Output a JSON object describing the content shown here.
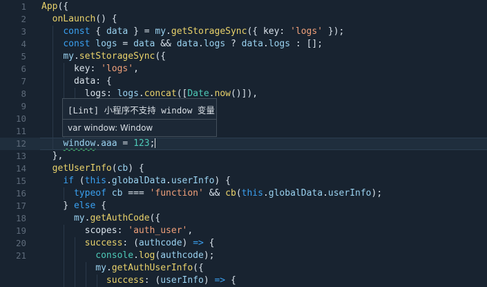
{
  "editor": {
    "lines": [
      {
        "n": "1",
        "tokens": [
          [
            "fn",
            "App"
          ],
          [
            "plain",
            "({"
          ]
        ]
      },
      {
        "n": "2",
        "tokens": [
          [
            "plain",
            "  "
          ],
          [
            "fn",
            "onLaunch"
          ],
          [
            "plain",
            "() {"
          ]
        ]
      },
      {
        "n": "3",
        "tokens": [
          [
            "plain",
            "    "
          ],
          [
            "kw",
            "const"
          ],
          [
            "plain",
            " { "
          ],
          [
            "var",
            "data"
          ],
          [
            "plain",
            " } = "
          ],
          [
            "var",
            "my"
          ],
          [
            "plain",
            "."
          ],
          [
            "fn",
            "getStorageSync"
          ],
          [
            "plain",
            "({ "
          ],
          [
            "prop",
            "key"
          ],
          [
            "plain",
            ": "
          ],
          [
            "str",
            "'logs'"
          ],
          [
            "plain",
            " });"
          ]
        ]
      },
      {
        "n": "4",
        "tokens": [
          [
            "plain",
            "    "
          ],
          [
            "kw",
            "const"
          ],
          [
            "plain",
            " "
          ],
          [
            "var",
            "logs"
          ],
          [
            "plain",
            " = "
          ],
          [
            "var",
            "data"
          ],
          [
            "plain",
            " && "
          ],
          [
            "var",
            "data"
          ],
          [
            "plain",
            "."
          ],
          [
            "var",
            "logs"
          ],
          [
            "plain",
            " ? "
          ],
          [
            "var",
            "data"
          ],
          [
            "plain",
            "."
          ],
          [
            "var",
            "logs"
          ],
          [
            "plain",
            " : [];"
          ]
        ]
      },
      {
        "n": "5",
        "tokens": [
          [
            "plain",
            "    "
          ],
          [
            "var",
            "my"
          ],
          [
            "plain",
            "."
          ],
          [
            "fn",
            "setStorageSync"
          ],
          [
            "plain",
            "({"
          ]
        ]
      },
      {
        "n": "6",
        "tokens": [
          [
            "plain",
            "      "
          ],
          [
            "prop",
            "key"
          ],
          [
            "plain",
            ": "
          ],
          [
            "str",
            "'logs'"
          ],
          [
            "plain",
            ","
          ]
        ]
      },
      {
        "n": "7",
        "tokens": [
          [
            "plain",
            "      "
          ],
          [
            "prop",
            "data"
          ],
          [
            "plain",
            ": {"
          ]
        ]
      },
      {
        "n": "8",
        "tokens": [
          [
            "plain",
            "        "
          ],
          [
            "prop",
            "logs"
          ],
          [
            "plain",
            ": "
          ],
          [
            "var",
            "logs"
          ],
          [
            "plain",
            "."
          ],
          [
            "fn",
            "concat"
          ],
          [
            "plain",
            "(["
          ],
          [
            "cls",
            "Date"
          ],
          [
            "plain",
            "."
          ],
          [
            "fn",
            "now"
          ],
          [
            "plain",
            "()]),"
          ]
        ]
      },
      {
        "n": "9",
        "tokens": []
      },
      {
        "n": "10",
        "tokens": []
      },
      {
        "n": "11",
        "tokens": []
      },
      {
        "n": "12",
        "tokens": [
          [
            "plain",
            "    "
          ],
          [
            "var squiggle",
            "window"
          ],
          [
            "plain",
            "."
          ],
          [
            "var",
            "aaa"
          ],
          [
            "plain",
            " = "
          ],
          [
            "cls",
            "123"
          ],
          [
            "plain",
            ";"
          ]
        ],
        "active": true
      },
      {
        "n": "13",
        "tokens": [
          [
            "plain",
            "  },"
          ]
        ]
      },
      {
        "n": "14",
        "tokens": [
          [
            "plain",
            "  "
          ],
          [
            "fn",
            "getUserInfo"
          ],
          [
            "plain",
            "("
          ],
          [
            "var",
            "cb"
          ],
          [
            "plain",
            ") {"
          ]
        ]
      },
      {
        "n": "15",
        "tokens": [
          [
            "plain",
            "    "
          ],
          [
            "kw",
            "if"
          ],
          [
            "plain",
            " ("
          ],
          [
            "kw",
            "this"
          ],
          [
            "plain",
            "."
          ],
          [
            "var",
            "globalData"
          ],
          [
            "plain",
            "."
          ],
          [
            "var",
            "userInfo"
          ],
          [
            "plain",
            ") {"
          ]
        ]
      },
      {
        "n": "16",
        "tokens": [
          [
            "plain",
            "      "
          ],
          [
            "kw",
            "typeof"
          ],
          [
            "plain",
            " "
          ],
          [
            "var",
            "cb"
          ],
          [
            "plain",
            " === "
          ],
          [
            "str",
            "'function'"
          ],
          [
            "plain",
            " && "
          ],
          [
            "fn",
            "cb"
          ],
          [
            "plain",
            "("
          ],
          [
            "kw",
            "this"
          ],
          [
            "plain",
            "."
          ],
          [
            "var",
            "globalData"
          ],
          [
            "plain",
            "."
          ],
          [
            "var",
            "userInfo"
          ],
          [
            "plain",
            ");"
          ]
        ]
      },
      {
        "n": "17",
        "tokens": [
          [
            "plain",
            "    } "
          ],
          [
            "kw",
            "else"
          ],
          [
            "plain",
            " {"
          ]
        ]
      },
      {
        "n": "18",
        "tokens": [
          [
            "plain",
            "      "
          ],
          [
            "var",
            "my"
          ],
          [
            "plain",
            "."
          ],
          [
            "fn",
            "getAuthCode"
          ],
          [
            "plain",
            "({"
          ]
        ]
      },
      {
        "n": "19",
        "tokens": [
          [
            "plain",
            "        "
          ],
          [
            "prop",
            "scopes"
          ],
          [
            "plain",
            ": "
          ],
          [
            "str",
            "'auth_user'"
          ],
          [
            "plain",
            ","
          ]
        ]
      },
      {
        "n": "20",
        "tokens": [
          [
            "plain",
            "        "
          ],
          [
            "fn",
            "success"
          ],
          [
            "plain",
            ": ("
          ],
          [
            "var",
            "authcode"
          ],
          [
            "plain",
            ") "
          ],
          [
            "kw",
            "=>"
          ],
          [
            "plain",
            " {"
          ]
        ]
      },
      {
        "n": "21",
        "tokens": [
          [
            "plain",
            "          "
          ],
          [
            "cls",
            "console"
          ],
          [
            "plain",
            "."
          ],
          [
            "fn",
            "log"
          ],
          [
            "plain",
            "("
          ],
          [
            "var",
            "authcode"
          ],
          [
            "plain",
            ");"
          ]
        ]
      },
      {
        "n": "",
        "tokens": [
          [
            "plain",
            "          "
          ],
          [
            "var",
            "my"
          ],
          [
            "plain",
            "."
          ],
          [
            "fn",
            "getAuthUserInfo"
          ],
          [
            "plain",
            "({"
          ]
        ]
      },
      {
        "n": "",
        "tokens": [
          [
            "plain",
            "            "
          ],
          [
            "fn",
            "success"
          ],
          [
            "plain",
            ": ("
          ],
          [
            "var",
            "userInfo"
          ],
          [
            "plain",
            ") "
          ],
          [
            "kw",
            "=>"
          ],
          [
            "plain",
            " {"
          ]
        ]
      }
    ]
  },
  "tooltip": {
    "title": "[Lint] 小程序不支持 window 变量",
    "signature": "var window: Window"
  },
  "colors": {
    "background": "#182330",
    "keyword": "#3aa0f0",
    "function": "#e9d26b",
    "string": "#f0a07a",
    "lint_squiggle": "#48c774"
  }
}
